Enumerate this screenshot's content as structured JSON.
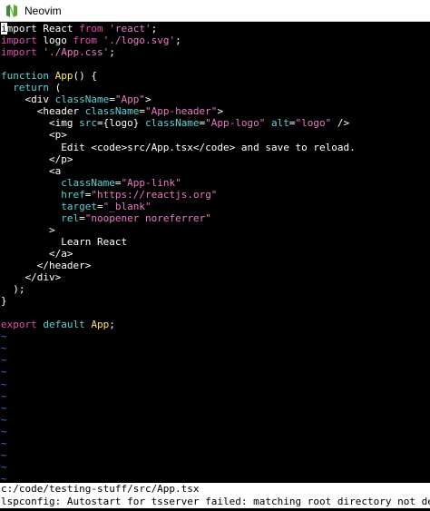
{
  "window": {
    "title": "Neovim",
    "icon": "neovim-logo-icon"
  },
  "colors": {
    "keyword": "#e74ab8",
    "string": "#e97ac3",
    "attribute": "#57d6d9",
    "identifier": "#ffe566",
    "text": "#ffffff",
    "tilde": "#4a6fd8",
    "background": "#000000"
  },
  "buffer": {
    "lines": [
      [
        [
          "cursor",
          "i"
        ],
        [
          "plain",
          "mport React "
        ],
        [
          "kw",
          "from"
        ],
        [
          "plain",
          " "
        ],
        [
          "str",
          "'react'"
        ],
        [
          "plain",
          ";"
        ]
      ],
      [
        [
          "kw",
          "import"
        ],
        [
          "plain",
          " logo "
        ],
        [
          "kw",
          "from"
        ],
        [
          "plain",
          " "
        ],
        [
          "str",
          "'./logo.svg'"
        ],
        [
          "plain",
          ";"
        ]
      ],
      [
        [
          "kw",
          "import"
        ],
        [
          "plain",
          " "
        ],
        [
          "str",
          "'./App.css'"
        ],
        [
          "plain",
          ";"
        ]
      ],
      [],
      [
        [
          "attr",
          "function"
        ],
        [
          "plain",
          " "
        ],
        [
          "id",
          "App"
        ],
        [
          "plain",
          "() {"
        ]
      ],
      [
        [
          "plain",
          "  "
        ],
        [
          "attr",
          "return"
        ],
        [
          "plain",
          " ("
        ]
      ],
      [
        [
          "plain",
          "    <div "
        ],
        [
          "attr",
          "className"
        ],
        [
          "plain",
          "="
        ],
        [
          "str",
          "\"App\""
        ],
        [
          "plain",
          ">"
        ]
      ],
      [
        [
          "plain",
          "      <header "
        ],
        [
          "attr",
          "className"
        ],
        [
          "plain",
          "="
        ],
        [
          "str",
          "\"App-header\""
        ],
        [
          "plain",
          ">"
        ]
      ],
      [
        [
          "plain",
          "        <img "
        ],
        [
          "attr",
          "src"
        ],
        [
          "plain",
          "={logo} "
        ],
        [
          "attr",
          "className"
        ],
        [
          "plain",
          "="
        ],
        [
          "str",
          "\"App-logo\""
        ],
        [
          "plain",
          " "
        ],
        [
          "attr",
          "alt"
        ],
        [
          "plain",
          "="
        ],
        [
          "str",
          "\"logo\""
        ],
        [
          "plain",
          " />"
        ]
      ],
      [
        [
          "plain",
          "        <p>"
        ]
      ],
      [
        [
          "plain",
          "          Edit <code>src/App.tsx</code> and save to reload."
        ]
      ],
      [
        [
          "plain",
          "        </p>"
        ]
      ],
      [
        [
          "plain",
          "        <a"
        ]
      ],
      [
        [
          "plain",
          "          "
        ],
        [
          "attr",
          "className"
        ],
        [
          "plain",
          "="
        ],
        [
          "str",
          "\"App-link\""
        ]
      ],
      [
        [
          "plain",
          "          "
        ],
        [
          "attr",
          "href"
        ],
        [
          "plain",
          "="
        ],
        [
          "str",
          "\"https://reactjs.org\""
        ]
      ],
      [
        [
          "plain",
          "          "
        ],
        [
          "attr",
          "target"
        ],
        [
          "plain",
          "="
        ],
        [
          "str",
          "\"_blank\""
        ]
      ],
      [
        [
          "plain",
          "          "
        ],
        [
          "attr",
          "rel"
        ],
        [
          "plain",
          "="
        ],
        [
          "str",
          "\"noopener noreferrer\""
        ]
      ],
      [
        [
          "plain",
          "        >"
        ]
      ],
      [
        [
          "plain",
          "          Learn React"
        ]
      ],
      [
        [
          "plain",
          "        </a>"
        ]
      ],
      [
        [
          "plain",
          "      </header>"
        ]
      ],
      [
        [
          "plain",
          "    </div>"
        ]
      ],
      [
        [
          "plain",
          "  );"
        ]
      ],
      [
        [
          "plain",
          "}"
        ]
      ],
      [],
      [
        [
          "kw",
          "export"
        ],
        [
          "plain",
          " "
        ],
        [
          "attr",
          "default"
        ],
        [
          "plain",
          " "
        ],
        [
          "id",
          "App"
        ],
        [
          "plain",
          ";"
        ]
      ]
    ],
    "tilde_lines": 13,
    "tilde_char": "~"
  },
  "statusline": {
    "text": "c:/code/testing-stuff/src/App.tsx"
  },
  "message": {
    "text": "lspconfig: Autostart for tsserver failed: matching root directory not detected."
  }
}
